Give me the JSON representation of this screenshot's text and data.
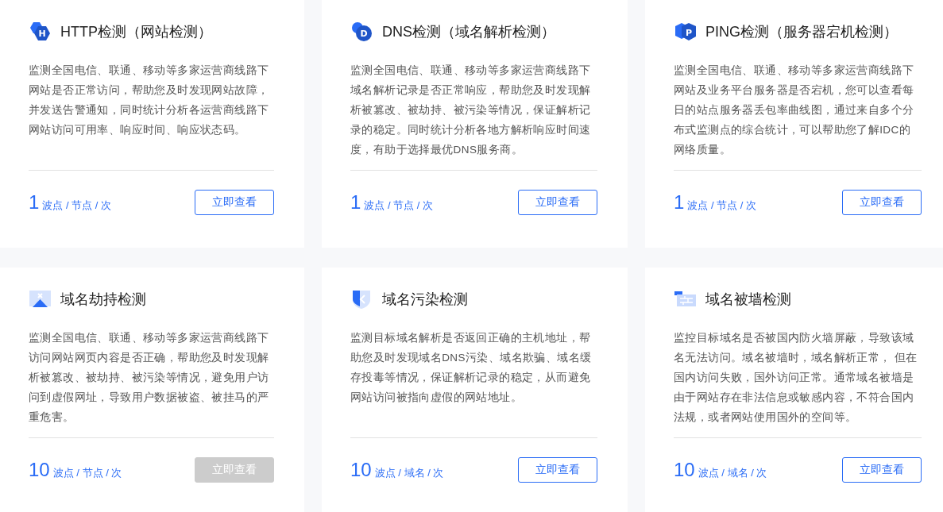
{
  "cards": [
    {
      "kind": "hexagon",
      "icon_letter": "H",
      "title": "HTTP检测（网站检测）",
      "description": "监测全国电信、联通、移动等多家运营商线路下网站是否正常访问，帮助您及时发现网站故障，并发送告警通知，同时统计分析各运营商线路下网站访问可用率、响应时间、响应状态码。",
      "count": "1",
      "unit": "波点 / 节点 / 次",
      "button": {
        "label": "立即查看",
        "disabled": false
      }
    },
    {
      "kind": "circle",
      "icon_letter": "D",
      "title": "DNS检测（域名解析检测）",
      "description": "监测全国电信、联通、移动等多家运营商线路下域名解析记录是否正常响应，帮助您及时发现解析被篡改、被劫持、被污染等情况，保证解析记录的稳定。同时统计分析各地方解析响应时间速度，有助于选择最优DNS服务商。",
      "count": "1",
      "unit": "波点 / 节点 / 次",
      "button": {
        "label": "立即查看",
        "disabled": false
      }
    },
    {
      "kind": "cube",
      "icon_letter": "P",
      "title": "PING检测（服务器宕机检测）",
      "description": "监测全国电信、联通、移动等多家运营商线路下网站及业务平台服务器是否宕机，您可以查看每日的站点服务器丢包率曲线图，通过来自多个分布式监测点的综合统计，可以帮助您了解IDC的网络质量。",
      "count": "1",
      "unit": "波点 / 节点 / 次",
      "button": {
        "label": "立即查看",
        "disabled": false
      }
    },
    {
      "kind": "hijack",
      "title": "域名劫持检测",
      "description": "监测全国电信、联通、移动等多家运营商线路下访问网站网页内容是否正确，帮助您及时发现解析被篡改、被劫持、被污染等情况，避免用户访问到虚假网址，导致用户数据被盗、被挂马的严重危害。",
      "count": "10",
      "unit": "波点 / 节点 / 次",
      "button": {
        "label": "立即查看",
        "disabled": true
      }
    },
    {
      "kind": "shield",
      "title": "域名污染检测",
      "description": "监测目标域名解析是否返回正确的主机地址，帮助您及时发现域名DNS污染、域名欺骗、域名缓存投毒等情况，保证解析记录的稳定，从而避免网站访问被指向虚假的网站地址。",
      "count": "10",
      "unit": "波点 / 域名 / 次",
      "button": {
        "label": "立即查看",
        "disabled": false
      }
    },
    {
      "kind": "wall",
      "title": "域名被墙检测",
      "description": "监控目标域名是否被国内防火墙屏蔽，导致该域名无法访问。域名被墙时，域名解析正常， 但在国内访问失败，国外访问正常。通常域名被墙是由于网站存在非法信息或敏感内容，不符合国内法规，或者网站使用国外的空间等。",
      "count": "10",
      "unit": "波点 / 域名 / 次",
      "button": {
        "label": "立即查看",
        "disabled": false
      }
    }
  ]
}
